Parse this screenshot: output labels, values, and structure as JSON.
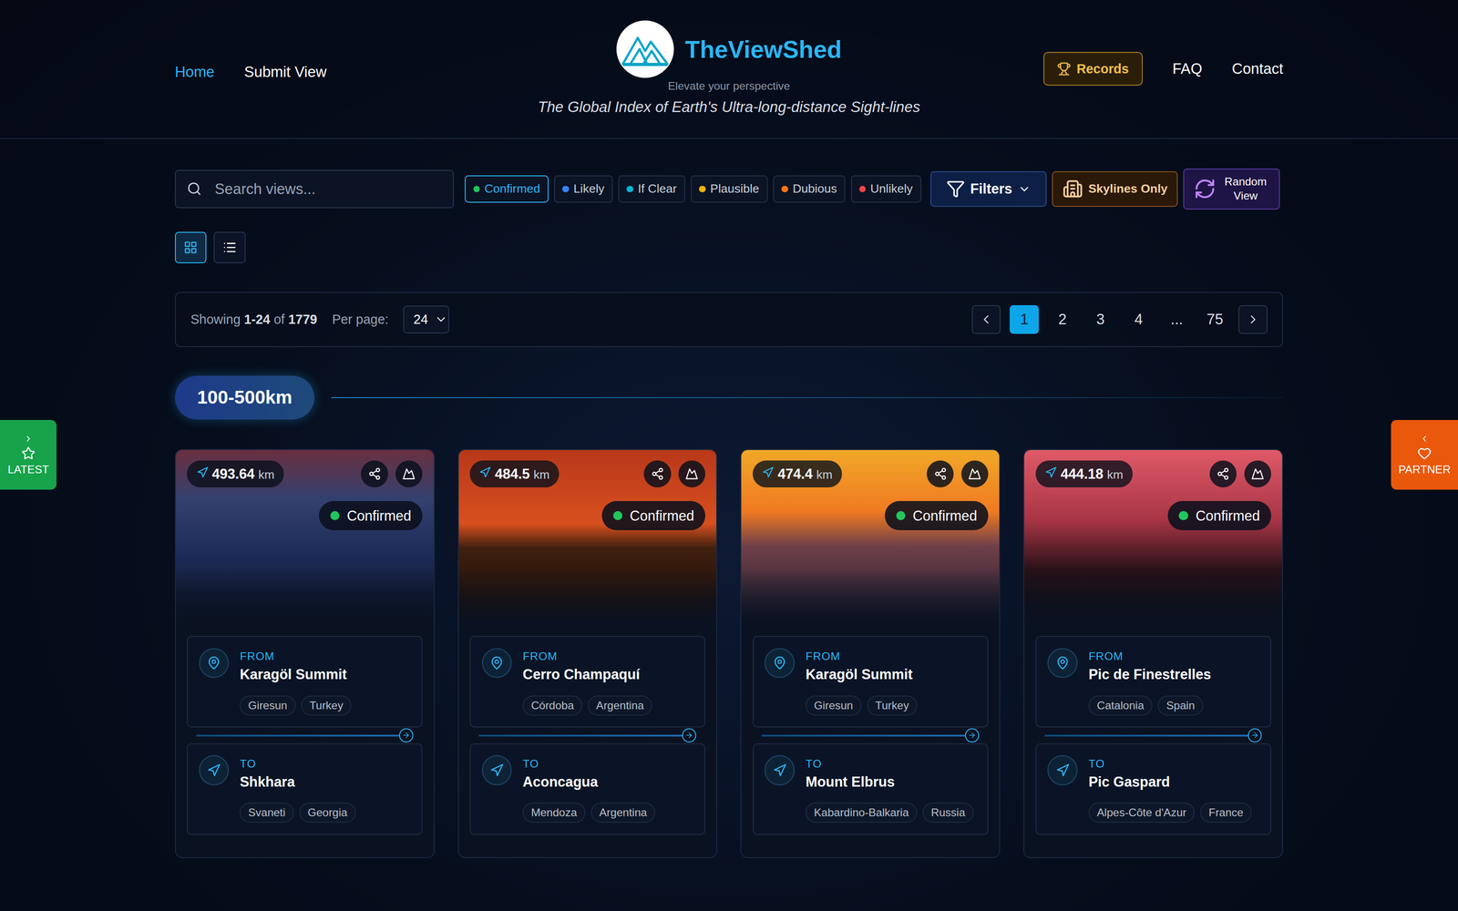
{
  "header": {
    "nav": [
      {
        "label": "Home",
        "selected": true
      },
      {
        "label": "Submit View",
        "selected": false
      }
    ],
    "brand": {
      "title": "TheViewShed",
      "subtitle": "Elevate your perspective",
      "tagline": "The Global Index of Earth's Ultra-long-distance Sight-lines"
    },
    "right_nav": [
      {
        "label": "Records",
        "kind": "highlight"
      },
      {
        "label": "FAQ",
        "kind": "link"
      },
      {
        "label": "Contact",
        "kind": "link"
      }
    ]
  },
  "search": {
    "placeholder": "Search views..."
  },
  "status_filters": [
    {
      "label": "Confirmed",
      "selected": true,
      "color": "#22c55e"
    },
    {
      "label": "Likely",
      "selected": false,
      "color": "#3b82f6"
    },
    {
      "label": "If Clear",
      "selected": false,
      "color": "#06b6d4"
    },
    {
      "label": "Plausible",
      "selected": false,
      "color": "#eab308"
    },
    {
      "label": "Dubious",
      "selected": false,
      "color": "#f97316"
    },
    {
      "label": "Unlikely",
      "selected": false,
      "color": "#ef4444"
    }
  ],
  "buttons": {
    "filters": "Filters",
    "skylines": "Skylines Only",
    "random": "Random View"
  },
  "view_modes": [
    {
      "kind": "grid",
      "selected": true
    },
    {
      "kind": "list",
      "selected": false
    }
  ],
  "pagination": {
    "prefix": "Showing",
    "range": "1-24",
    "of": "of",
    "total": "1779",
    "per_page_label": "Per page:",
    "per_page": "24",
    "pages": [
      {
        "label": "1",
        "selected": true
      },
      {
        "label": "2",
        "selected": false
      },
      {
        "label": "3",
        "selected": false
      },
      {
        "label": "4",
        "selected": false
      },
      {
        "label": "...",
        "selected": false
      },
      {
        "label": "75",
        "selected": false
      }
    ]
  },
  "section": {
    "label": "100-500km"
  },
  "cards": [
    {
      "distance": "493.64",
      "unit": "km",
      "status": "Confirmed",
      "status_color": "#22c55e",
      "from": {
        "label": "FROM",
        "name": "Karagöl Summit",
        "tags": [
          "Giresun",
          "Turkey"
        ]
      },
      "to": {
        "label": "TO",
        "name": "Shkhara",
        "tags": [
          "Svaneti",
          "Georgia"
        ]
      }
    },
    {
      "distance": "484.5",
      "unit": "km",
      "status": "Confirmed",
      "status_color": "#22c55e",
      "from": {
        "label": "FROM",
        "name": "Cerro Champaquí",
        "tags": [
          "Córdoba",
          "Argentina"
        ]
      },
      "to": {
        "label": "TO",
        "name": "Aconcagua",
        "tags": [
          "Mendoza",
          "Argentina"
        ]
      }
    },
    {
      "distance": "474.4",
      "unit": "km",
      "status": "Confirmed",
      "status_color": "#22c55e",
      "from": {
        "label": "FROM",
        "name": "Karagöl Summit",
        "tags": [
          "Giresun",
          "Turkey"
        ]
      },
      "to": {
        "label": "TO",
        "name": "Mount Elbrus",
        "tags": [
          "Kabardino-Balkaria",
          "Russia"
        ]
      }
    },
    {
      "distance": "444.18",
      "unit": "km",
      "status": "Confirmed",
      "status_color": "#22c55e",
      "from": {
        "label": "FROM",
        "name": "Pic de Finestrelles",
        "tags": [
          "Catalonia",
          "Spain"
        ]
      },
      "to": {
        "label": "TO",
        "name": "Pic Gaspard",
        "tags": [
          "Alpes-Côte d'Azur",
          "France"
        ]
      }
    }
  ],
  "side_tabs": {
    "left": "LATEST",
    "right": "PARTNER"
  }
}
